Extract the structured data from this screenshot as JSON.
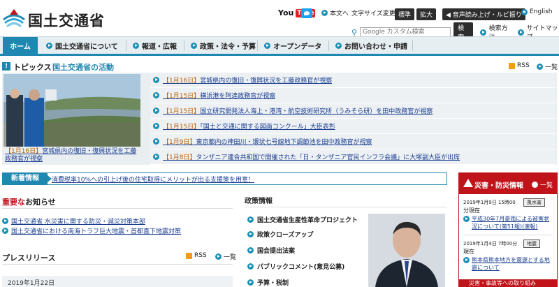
{
  "header": {
    "site_title": "国土交通省",
    "youtube": "You",
    "youtube_tube": "Tube",
    "text_only": "本文へ",
    "text_size_label": "文字サイズ変更",
    "size_standard": "標準",
    "size_large": "拡大",
    "read_aloud": "音声読み上げ・ルビ振り",
    "english": "English",
    "search_placeholder": "Google カスタム検索",
    "search_button": "検索",
    "search_method": "検索方法",
    "sitemap": "サイトマップ"
  },
  "nav": {
    "items": [
      "ホーム",
      "国土交通省について",
      "報道・広報",
      "政策・法令・予算",
      "オープンデータ",
      "お問い合わせ・申請"
    ]
  },
  "topics": {
    "mark": "!",
    "title": "トピックス",
    "subtitle": "国土交通省の活動",
    "rss": "RSS",
    "list_all": "一覧",
    "photo_caption_bracket": "【1月16日】",
    "photo_caption": "宮城県内の復旧・復興状況を工藤政務官が視察",
    "items": [
      {
        "date": "【1月16日】",
        "text": "宮城県内の復旧・復興状況を工藤政務官が視察"
      },
      {
        "date": "【1月15日】",
        "text": "横浜港を阿達政務官が視察"
      },
      {
        "date": "【1月15日】",
        "text": "国立研究開発法人海上・港湾・航空技術研究所（うみそら研）を田中政務官が視察"
      },
      {
        "date": "【1月15日】",
        "text": "「国土と交通に関する図画コンクール」大臣表彰"
      },
      {
        "date": "【1月9日】",
        "text": "東京都内の神田川・環状七号線地下調節池を田中政務官が視察"
      },
      {
        "date": "【1月8日】",
        "text": "タンザニア連合共和国で開催された「日・タンザニア官民インフラ会議」に大塚副大臣が出席"
      }
    ]
  },
  "new_info": {
    "label": "新着情報",
    "text": "消費税率10%への引上げ後の住宅取得にメリットが出る支援策を用意！"
  },
  "important": {
    "title_red": "重要な",
    "title_rest": "お知らせ",
    "items": [
      "国土交通省 水災害に関する防災・減災対策本部",
      "国土交通省における南海トラフ巨大地震・首都直下地震対策"
    ]
  },
  "press": {
    "title": "プレスリリース",
    "rss": "RSS",
    "list_all": "一覧",
    "date": "2019年1月22日"
  },
  "policy": {
    "title": "政策情報",
    "items": [
      "国土交通省生産性革命プロジェクト",
      "政策クローズアップ",
      "国会提出法案",
      "パブリックコメント(意見公募)",
      "予算・税制"
    ]
  },
  "disaster": {
    "title": "災害・防災情報",
    "list_all": "一覧",
    "entries": [
      {
        "date": "2019年1月9日 15時00",
        "badge": "風水害",
        "sub": "分現在",
        "link": "平成30年7月豪雨による被害状況について(第51報)(速報)"
      },
      {
        "date": "2019年1月4日 7時00分",
        "badge": "地震",
        "sub": "現在",
        "link": "熊本県熊本地方を震源とする地震について"
      }
    ],
    "footer": "災害・事故等への取り組み"
  }
}
